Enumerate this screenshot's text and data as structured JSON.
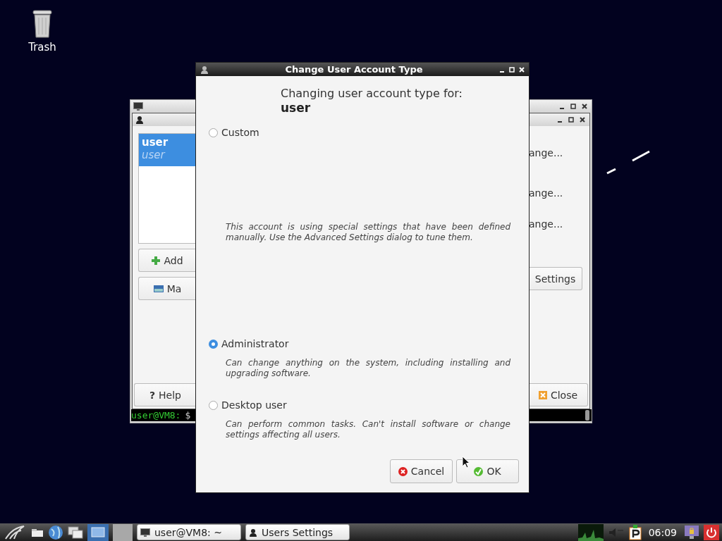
{
  "desktop_icons": [
    {
      "label": "Trash"
    }
  ],
  "terminal_window": {
    "prompt": "user@VM8:",
    "prompt_symbol": "$"
  },
  "users_window": {
    "users": [
      {
        "name": "user",
        "login": "user",
        "selected": true
      }
    ],
    "left_buttons": [
      {
        "label": "Add",
        "kind": "add"
      },
      {
        "label": "Ma",
        "kind": "manage"
      }
    ],
    "help_button": {
      "icon": "?",
      "label": "Help"
    },
    "change_links": [
      "ange...",
      "ange...",
      "ange..."
    ],
    "settings_button": "Settings",
    "close_button": "Close"
  },
  "dialog": {
    "title": "Change User Account Type",
    "heading": "Changing user account type for:",
    "user": "user",
    "options": [
      {
        "label": "Custom",
        "selected": false,
        "description": "This account is using special settings that have been defined manually. Use the Advanced Settings dialog to tune them."
      },
      {
        "label": "Administrator",
        "selected": true,
        "description": "Can change anything on the system, including installing and upgrading software."
      },
      {
        "label": "Desktop user",
        "selected": false,
        "description": "Can perform common tasks. Can't install software or change settings affecting all users."
      }
    ],
    "buttons": [
      {
        "label": "Cancel",
        "kind": "cancel"
      },
      {
        "label": "OK",
        "kind": "ok"
      }
    ]
  },
  "taskbar": {
    "tasks": [
      {
        "label": "user@VM8: ~",
        "kind": "terminal"
      },
      {
        "label": "Users Settings",
        "kind": "users"
      }
    ],
    "clock": "06:09"
  }
}
